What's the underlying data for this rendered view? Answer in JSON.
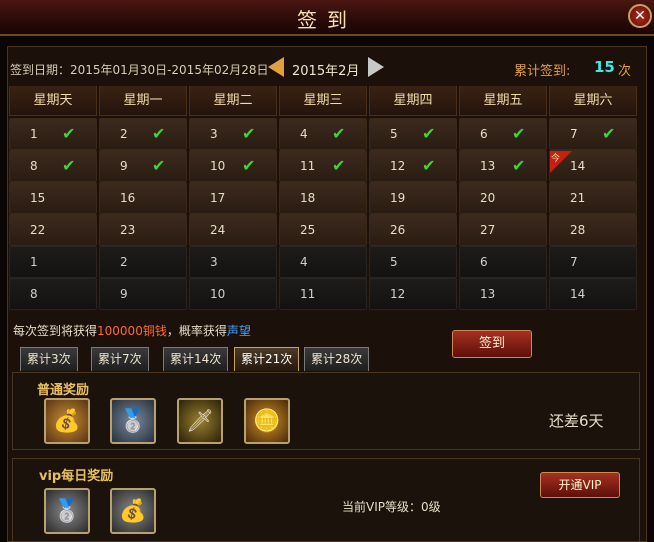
{
  "window": {
    "title": "签到",
    "close_label": "✕"
  },
  "info": {
    "date_range": "签到日期：2015年01月30日-2015年02月28日",
    "month": "2015年2月",
    "total_label": "累计签到:",
    "total_count": "15",
    "total_unit": "次"
  },
  "calendar": {
    "weekdays": [
      "星期天",
      "星期一",
      "星期二",
      "星期三",
      "星期四",
      "星期五",
      "星期六"
    ],
    "rows": [
      [
        {
          "n": "1",
          "c": true
        },
        {
          "n": "2",
          "c": true
        },
        {
          "n": "3",
          "c": true
        },
        {
          "n": "4",
          "c": true
        },
        {
          "n": "5",
          "c": true
        },
        {
          "n": "6",
          "c": true
        },
        {
          "n": "7",
          "c": true
        }
      ],
      [
        {
          "n": "8",
          "c": true
        },
        {
          "n": "9",
          "c": true
        },
        {
          "n": "10",
          "c": true
        },
        {
          "n": "11",
          "c": true
        },
        {
          "n": "12",
          "c": true
        },
        {
          "n": "13",
          "c": true
        },
        {
          "n": "14",
          "c": false,
          "today": true
        }
      ],
      [
        {
          "n": "15"
        },
        {
          "n": "16"
        },
        {
          "n": "17"
        },
        {
          "n": "18"
        },
        {
          "n": "19"
        },
        {
          "n": "20"
        },
        {
          "n": "21"
        }
      ],
      [
        {
          "n": "22"
        },
        {
          "n": "23"
        },
        {
          "n": "24"
        },
        {
          "n": "25"
        },
        {
          "n": "26"
        },
        {
          "n": "27"
        },
        {
          "n": "28"
        }
      ],
      [
        {
          "n": "1",
          "next": true
        },
        {
          "n": "2",
          "next": true
        },
        {
          "n": "3",
          "next": true
        },
        {
          "n": "4",
          "next": true
        },
        {
          "n": "5",
          "next": true
        },
        {
          "n": "6",
          "next": true
        },
        {
          "n": "7",
          "next": true
        }
      ],
      [
        {
          "n": "8",
          "next": true
        },
        {
          "n": "9",
          "next": true
        },
        {
          "n": "10",
          "next": true
        },
        {
          "n": "11",
          "next": true
        },
        {
          "n": "12",
          "next": true
        },
        {
          "n": "13",
          "next": true
        },
        {
          "n": "14",
          "next": true
        }
      ]
    ],
    "today_mark": "今",
    "check_mark": "✔"
  },
  "reward_note": {
    "prefix": "每次签到将获得",
    "amount": "100000铜钱",
    "middle": "，概率获得",
    "item": "声望"
  },
  "signin_button": "签到",
  "tabs": [
    "累计3次",
    "累计7次",
    "累计14次",
    "累计21次",
    "累计28次"
  ],
  "active_tab": 3,
  "normal_rewards": {
    "title": "普通奖励",
    "items": [
      {
        "icon": "money-bag-icon",
        "glyph": "💰"
      },
      {
        "icon": "silver-bar-icon",
        "glyph": "🥈"
      },
      {
        "icon": "weapon-icon",
        "glyph": "🗡"
      },
      {
        "icon": "gold-pile-icon",
        "glyph": "🪙"
      }
    ],
    "remaining": "还差6天"
  },
  "vip_rewards": {
    "title": "vip每日奖励",
    "items": [
      {
        "icon": "silver-ingot-icon",
        "glyph": "🥈"
      },
      {
        "icon": "silver-bag-icon",
        "glyph": "💰"
      }
    ],
    "vip_level": "当前VIP等级：0级",
    "vip_button": "开通VIP"
  },
  "colors": {
    "accent_gold": "#e0a040",
    "check_green": "#40d040",
    "count_cyan": "#3ee8e0",
    "today_red": "#c82010"
  }
}
